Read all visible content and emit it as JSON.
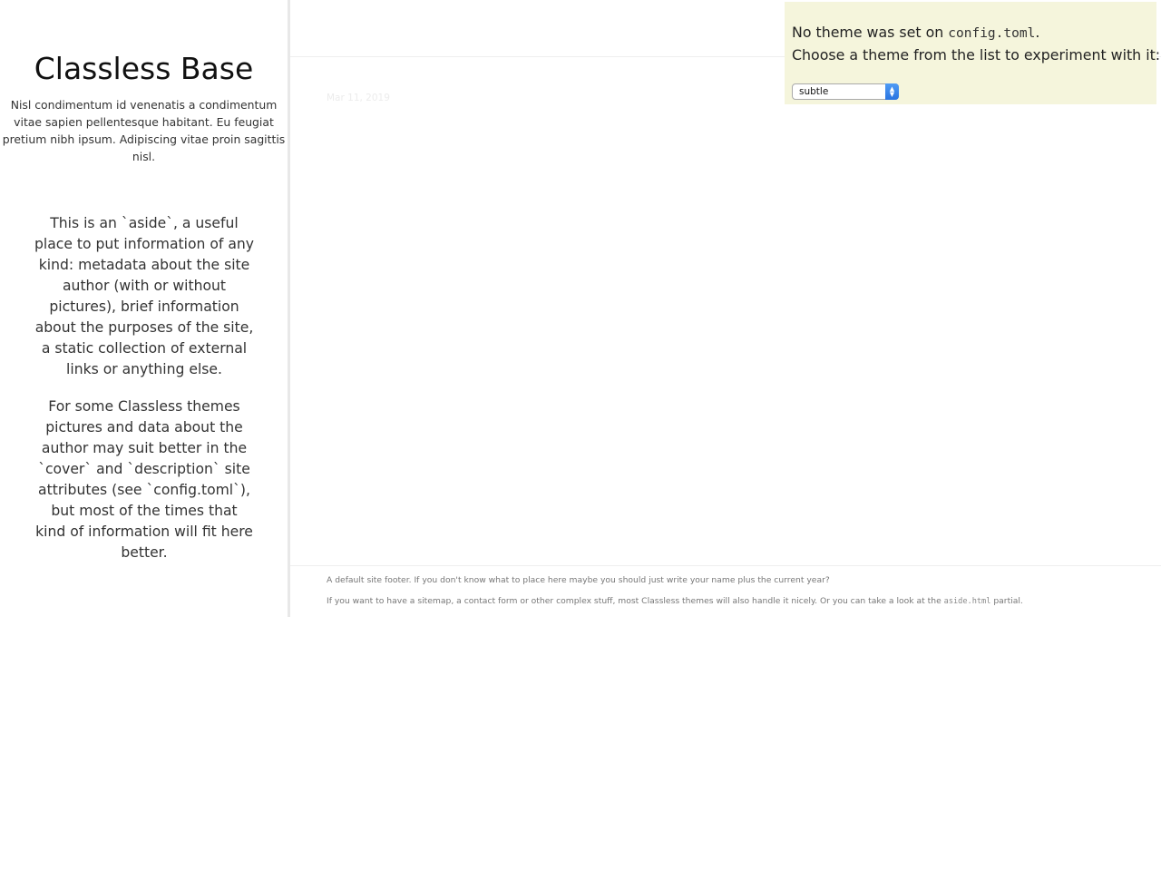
{
  "sidebar": {
    "title": "Classless Base",
    "description": "Nisl condimentum id venenatis a condimentum vitae sapien pellentesque habitant. Eu feugiat pretium nibh ipsum. Adipiscing vitae proin sagittis nisl.",
    "aside_paragraphs": [
      "This is an `aside`, a useful place to put information of any kind: metadata about the site author (with or without pictures), brief information about the purposes of the site, a static collection of external links or anything else.",
      "For some Classless themes pictures and data about the author may suit better in the `cover` and `description` site attributes (see `config.toml`), but most of the times that kind of information will fit here better."
    ]
  },
  "main": {
    "post_date": "Mar 11, 2019"
  },
  "footer": {
    "line1": "A default site footer. If you don't know what to place here maybe you should just write your name plus the current year?",
    "line2_prefix": "If you want to have a sitemap, a contact form or other complex stuff, most Classless themes will also handle it nicely. Or you can take a look at the",
    "line2_code": "aside.html",
    "line2_suffix": "partial."
  },
  "theme_box": {
    "msg_prefix": "No theme was set on",
    "msg_code": "config.toml",
    "msg_suffix": ".",
    "msg_line2": "Choose a theme from the list to experiment with it:",
    "selected_theme": "subtle",
    "background_color": "#f5f5dc",
    "select_arrow_color": "#2a74e0"
  }
}
